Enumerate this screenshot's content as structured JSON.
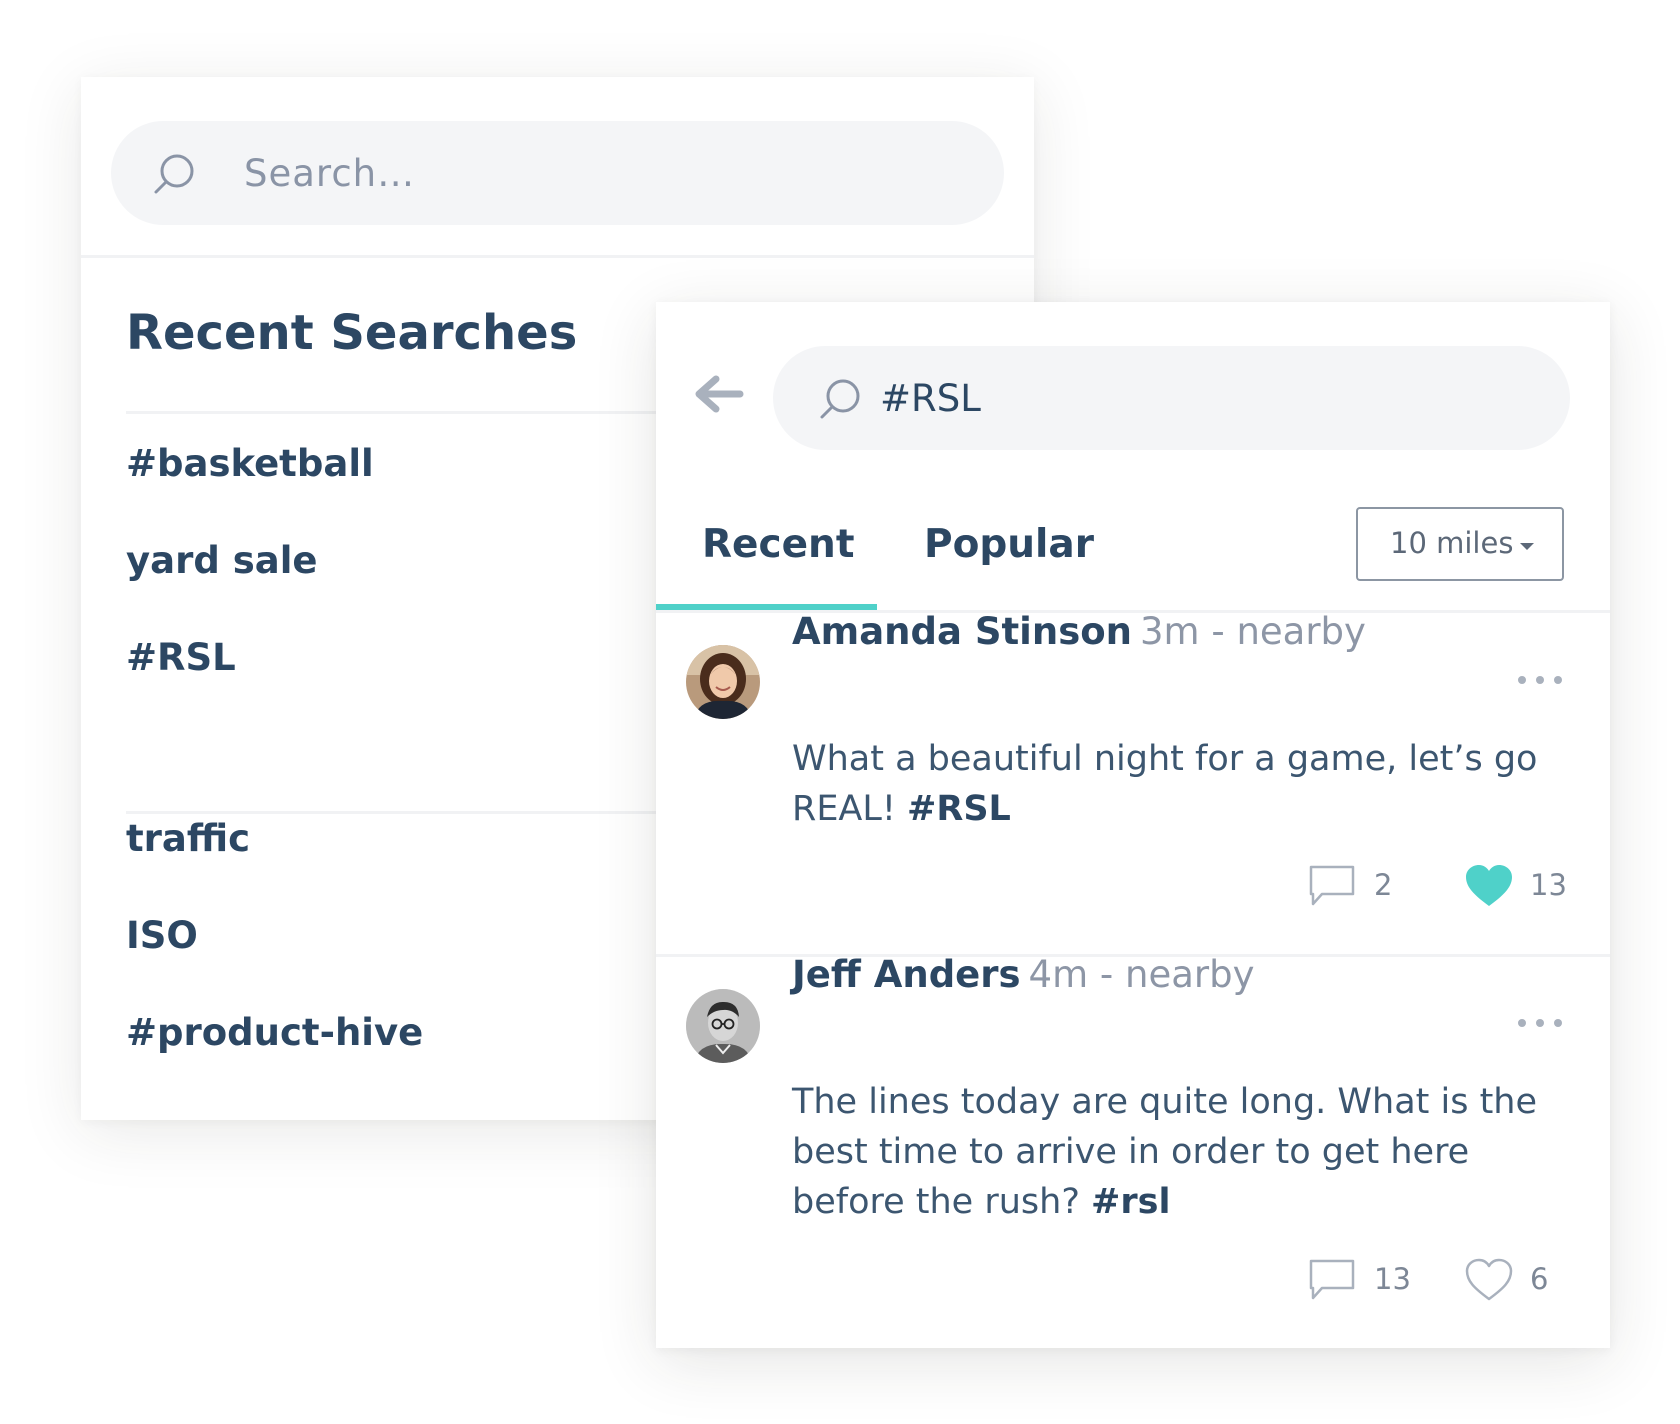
{
  "recent_panel": {
    "search_placeholder": "Search…",
    "title": "Recent Searches",
    "items_group_1": [
      "#basketball",
      "yard sale",
      "#RSL"
    ],
    "items_group_2": [
      "traffic",
      "ISO",
      "#product-hive"
    ]
  },
  "feed_panel": {
    "search_value": "#RSL",
    "tabs": [
      {
        "label": "Recent",
        "active": true
      },
      {
        "label": "Popular",
        "active": false
      }
    ],
    "distance_filter": "10 miles",
    "accent_color": "#4fd1c9",
    "text_color": "#2c4763",
    "posts": [
      {
        "author": "Amanda Stinson",
        "meta": "3m - nearby",
        "text": "What a beautiful night for a game, let’s go REAL! ",
        "hashtag": "#RSL",
        "comment_count": "2",
        "like_count": "13",
        "liked": true,
        "avatar_icon": "avatar-woman"
      },
      {
        "author": "Jeff Anders",
        "meta": "4m - nearby",
        "text": "The lines today are quite long. What is the best time to arrive in order to get here before the rush? ",
        "hashtag": "#rsl",
        "comment_count": "13",
        "like_count": "6",
        "liked": false,
        "avatar_icon": "avatar-man"
      }
    ]
  }
}
